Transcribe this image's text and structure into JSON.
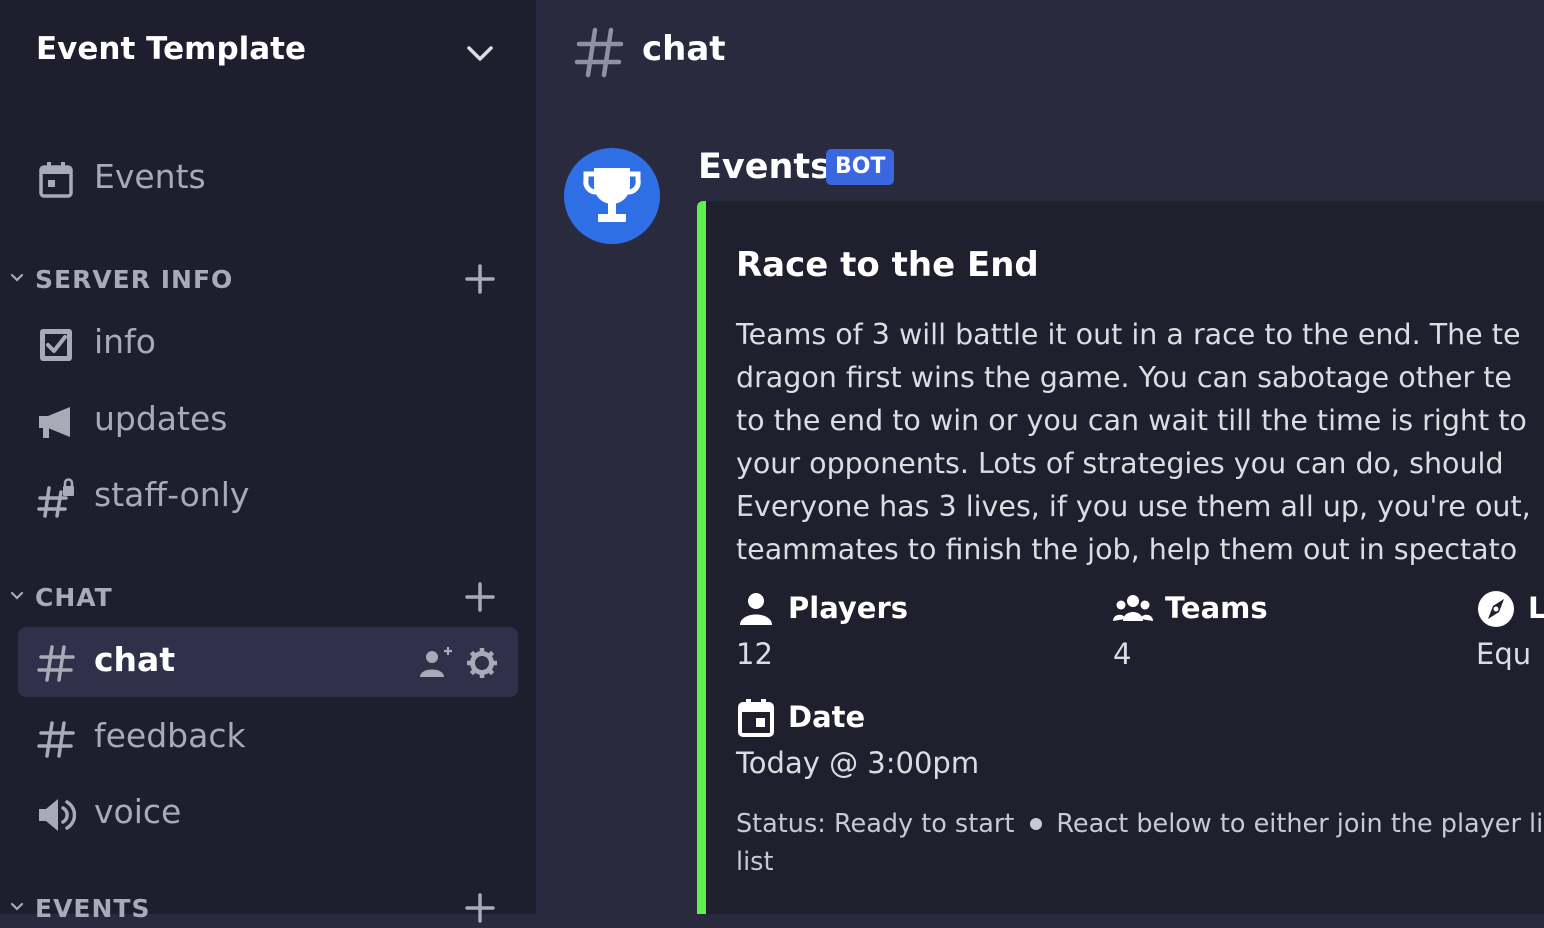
{
  "server": {
    "name": "Event Template"
  },
  "sidebar": {
    "events_item": {
      "label": "Events",
      "icon": "calendar-icon"
    },
    "categories": [
      {
        "label": "SERVER INFO",
        "channels": [
          {
            "label": "info",
            "icon": "rules-checkbox-icon"
          },
          {
            "label": "updates",
            "icon": "megaphone-icon"
          },
          {
            "label": "staff-only",
            "icon": "locked-hash-icon"
          }
        ]
      },
      {
        "label": "CHAT",
        "channels": [
          {
            "label": "chat",
            "icon": "hash-icon",
            "active": true
          },
          {
            "label": "feedback",
            "icon": "hash-icon"
          },
          {
            "label": "voice",
            "icon": "speaker-icon"
          }
        ]
      },
      {
        "label": "EVENTS",
        "channels": []
      }
    ]
  },
  "channel": {
    "name": "chat"
  },
  "message": {
    "author": "Events",
    "badge": "BOT",
    "avatar_icon": "trophy-icon",
    "embed": {
      "accent_color": "#5ff04f",
      "title": "Race to the End",
      "description_lines": [
        "Teams of 3 will battle it out in a race to the end. The te",
        "dragon first wins the game. You can sabotage other te",
        "to the end to win or you can wait till the time is right to",
        "your opponents. Lots of strategies you can do, should",
        "Everyone has 3 lives, if you use them all up, you're out,",
        "teammates to finish the job, help them out in spectato"
      ],
      "fields": [
        {
          "name": "Players",
          "value": "12",
          "icon": "user-icon"
        },
        {
          "name": "Teams",
          "value": "4",
          "icon": "users-icon"
        },
        {
          "name": "L",
          "value": "Equ",
          "icon": "compass-icon"
        },
        {
          "name": "Date",
          "value": "Today @ 3:00pm",
          "icon": "calendar-icon"
        }
      ],
      "footer": {
        "status": "Status: Ready to start",
        "instruction": "React below to either join the player li",
        "instruction_cont": "list"
      }
    }
  },
  "colors": {
    "sidebar_bg": "#1e1e2e",
    "main_bg": "#2a2a3f",
    "avatar_bg": "#2e6fe6",
    "badge_bg": "#3a66e0"
  }
}
